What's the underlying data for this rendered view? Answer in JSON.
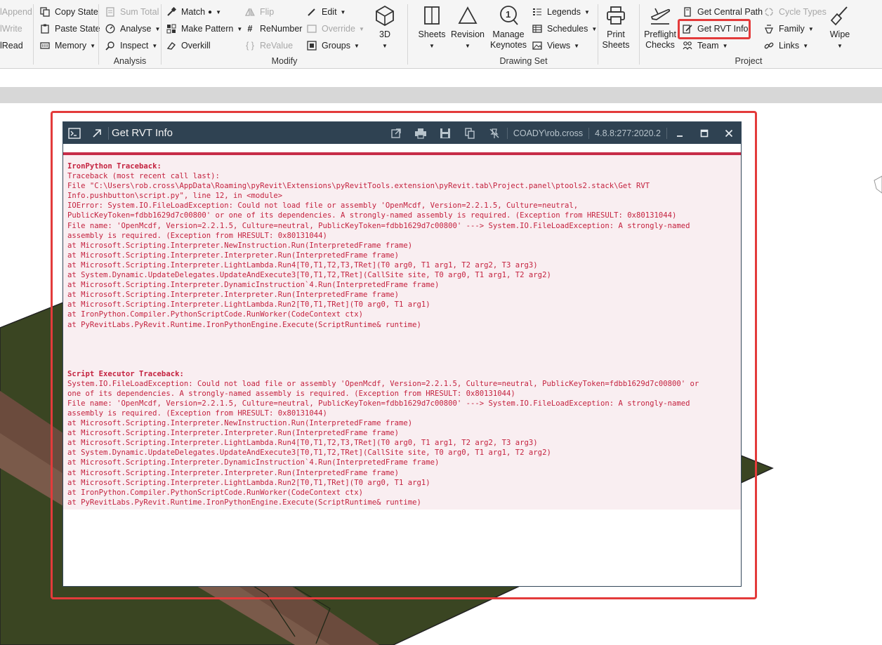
{
  "ribbon": {
    "clipped_panel": {
      "items": [
        "lAppend",
        "lWrite",
        "lRead"
      ]
    },
    "clipboard_panel": {
      "items": [
        "Copy State",
        "Paste State",
        "Memory"
      ]
    },
    "analysis_panel": {
      "title": "Analysis",
      "items": [
        "Sum Total",
        "Analyse",
        "Inspect"
      ]
    },
    "modify_panel": {
      "title": "Modify",
      "items": [
        "Match",
        "Make Pattern",
        "Overkill",
        "Flip",
        "ReNumber",
        "ReValue",
        "Edit",
        "Override",
        "Groups"
      ],
      "big": "3D"
    },
    "drawing_set_panel": {
      "title": "Drawing Set",
      "big": [
        "Sheets",
        "Revision",
        "Manage Keynotes"
      ],
      "items": [
        "Legends",
        "Schedules",
        "Views"
      ],
      "print": "Print Sheets"
    },
    "project_panel": {
      "title": "Project",
      "big": [
        "Preflight Checks",
        "Wipe"
      ],
      "items": [
        "Get Central Path",
        "Get RVT Info",
        "Team",
        "Cycle Types",
        "Family",
        "Links"
      ]
    }
  },
  "colors": {
    "highlight": "#e33b3b",
    "titlebar": "#2f4252",
    "error_text": "#c4223f",
    "error_bg": "#f9eef1"
  },
  "output_window": {
    "title": "Get RVT Info",
    "user": "COADY\\rob.cross",
    "version": "4.8.8:277:2020.2",
    "icons": [
      "terminal-icon",
      "pin-arrow-icon",
      "open-external-icon",
      "print-icon",
      "save-icon",
      "copy-icon",
      "debug-off-icon",
      "minimize-icon",
      "maximize-icon",
      "close-icon"
    ],
    "ironpython_header": "IronPython Traceback:",
    "ironpython_lines": [
      "Traceback (most recent call last):",
      "File \"C:\\Users\\rob.cross\\AppData\\Roaming\\pyRevit\\Extensions\\pyRevitTools.extension\\pyRevit.tab\\Project.panel\\ptools2.stack\\Get RVT",
      "Info.pushbutton\\script.py\", line 12, in <module>",
      "IOError: System.IO.FileLoadException: Could not load file or assembly 'OpenMcdf, Version=2.2.1.5, Culture=neutral,",
      "PublicKeyToken=fdbb1629d7c00800' or one of its dependencies. A strongly-named assembly is required. (Exception from HRESULT: 0x80131044)",
      "File name: 'OpenMcdf, Version=2.2.1.5, Culture=neutral, PublicKeyToken=fdbb1629d7c00800' ---> System.IO.FileLoadException: A strongly-named",
      "assembly is required. (Exception from HRESULT: 0x80131044)",
      "at Microsoft.Scripting.Interpreter.NewInstruction.Run(InterpretedFrame frame)",
      "at Microsoft.Scripting.Interpreter.Interpreter.Run(InterpretedFrame frame)",
      "at Microsoft.Scripting.Interpreter.LightLambda.Run4[T0,T1,T2,T3,TRet](T0 arg0, T1 arg1, T2 arg2, T3 arg3)",
      "at System.Dynamic.UpdateDelegates.UpdateAndExecute3[T0,T1,T2,TRet](CallSite site, T0 arg0, T1 arg1, T2 arg2)",
      "at Microsoft.Scripting.Interpreter.DynamicInstruction`4.Run(InterpretedFrame frame)",
      "at Microsoft.Scripting.Interpreter.Interpreter.Run(InterpretedFrame frame)",
      "at Microsoft.Scripting.Interpreter.LightLambda.Run2[T0,T1,TRet](T0 arg0, T1 arg1)",
      "at IronPython.Compiler.PythonScriptCode.RunWorker(CodeContext ctx)",
      "at PyRevitLabs.PyRevit.Runtime.IronPythonEngine.Execute(ScriptRuntime& runtime)"
    ],
    "executor_header": "Script Executor Traceback:",
    "executor_lines": [
      "System.IO.FileLoadException: Could not load file or assembly 'OpenMcdf, Version=2.2.1.5, Culture=neutral, PublicKeyToken=fdbb1629d7c00800' or",
      "one of its dependencies. A strongly-named assembly is required. (Exception from HRESULT: 0x80131044)",
      "File name: 'OpenMcdf, Version=2.2.1.5, Culture=neutral, PublicKeyToken=fdbb1629d7c00800' ---> System.IO.FileLoadException: A strongly-named",
      "assembly is required. (Exception from HRESULT: 0x80131044)",
      "at Microsoft.Scripting.Interpreter.NewInstruction.Run(InterpretedFrame frame)",
      "at Microsoft.Scripting.Interpreter.Interpreter.Run(InterpretedFrame frame)",
      "at Microsoft.Scripting.Interpreter.LightLambda.Run4[T0,T1,T2,T3,TRet](T0 arg0, T1 arg1, T2 arg2, T3 arg3)",
      "at System.Dynamic.UpdateDelegates.UpdateAndExecute3[T0,T1,T2,TRet](CallSite site, T0 arg0, T1 arg1, T2 arg2)",
      "at Microsoft.Scripting.Interpreter.DynamicInstruction`4.Run(InterpretedFrame frame)",
      "at Microsoft.Scripting.Interpreter.Interpreter.Run(InterpretedFrame frame)",
      "at Microsoft.Scripting.Interpreter.LightLambda.Run2[T0,T1,TRet](T0 arg0, T1 arg1)",
      "at IronPython.Compiler.PythonScriptCode.RunWorker(CodeContext ctx)",
      "at PyRevitLabs.PyRevit.Runtime.IronPythonEngine.Execute(ScriptRuntime& runtime)"
    ]
  }
}
